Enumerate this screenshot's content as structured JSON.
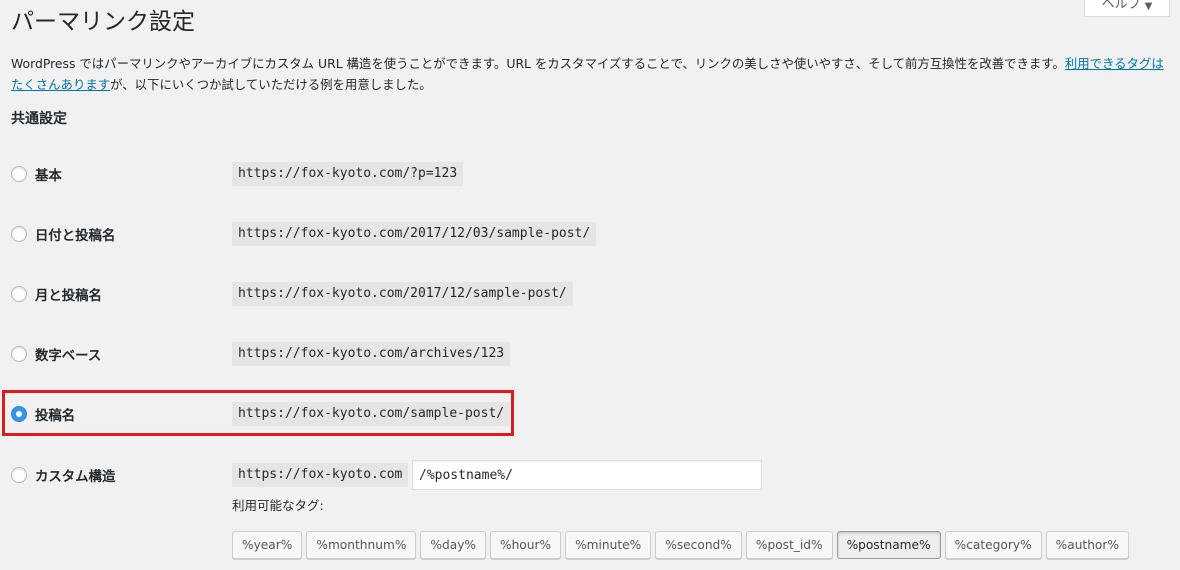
{
  "help_tab": {
    "label": "ヘルプ"
  },
  "page_title": "パーマリンク設定",
  "intro": {
    "text_before_link": "WordPress ではパーマリンクやアーカイブにカスタム URL 構造を使うことができます。URL をカスタマイズすることで、リンクの美しさや使いやすさ、そして前方互換性を改善できます。",
    "link_text": "利用できるタグはたくさんあります",
    "text_after_link": "が、以下にいくつか試していただける例を用意しました。"
  },
  "section_title": "共通設定",
  "options": [
    {
      "label": "基本",
      "example": "https://fox-kyoto.com/?p=123",
      "checked": false
    },
    {
      "label": "日付と投稿名",
      "example": "https://fox-kyoto.com/2017/12/03/sample-post/",
      "checked": false
    },
    {
      "label": "月と投稿名",
      "example": "https://fox-kyoto.com/2017/12/sample-post/",
      "checked": false
    },
    {
      "label": "数字ベース",
      "example": "https://fox-kyoto.com/archives/123",
      "checked": false
    },
    {
      "label": "投稿名",
      "example": "https://fox-kyoto.com/sample-post/",
      "checked": true
    },
    {
      "label": "カスタム構造",
      "example": "https://fox-kyoto.com",
      "checked": false
    }
  ],
  "custom_structure": {
    "value": "/%postname%/",
    "available_tags_label": "利用可能なタグ:",
    "tags": [
      "%year%",
      "%monthnum%",
      "%day%",
      "%hour%",
      "%minute%",
      "%second%",
      "%post_id%",
      "%postname%",
      "%category%",
      "%author%"
    ],
    "active_tag": "%postname%"
  },
  "colors": {
    "background": "#f1f1f1",
    "link": "#0073aa",
    "radio_checked": "#3596e9",
    "highlight_border": "#e0191f",
    "code_background": "#e5e5e5"
  }
}
